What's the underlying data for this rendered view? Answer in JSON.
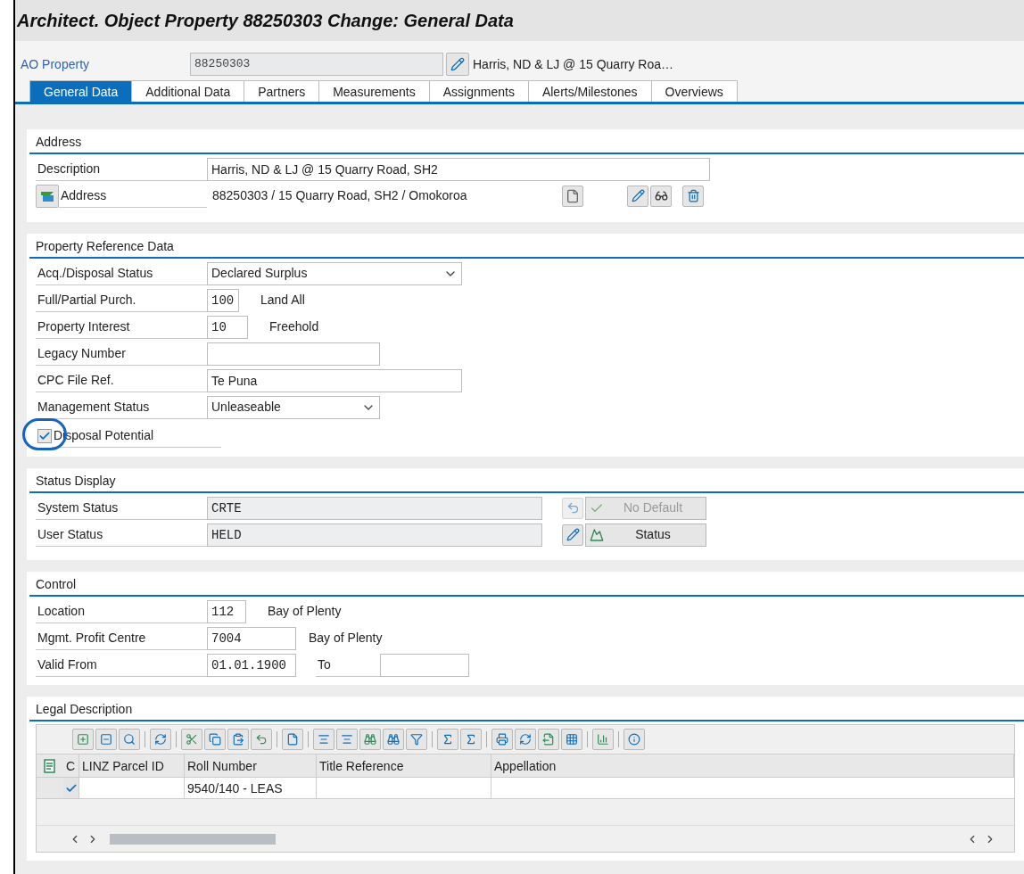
{
  "window": {
    "title": "Architect. Object Property 88250303 Change: General Data"
  },
  "header": {
    "label": "AO Property",
    "value": "88250303",
    "description": "Harris, ND & LJ @ 15 Quarry Roa…"
  },
  "tabs": [
    {
      "label": "General Data",
      "selected": true
    },
    {
      "label": "Additional Data",
      "selected": false
    },
    {
      "label": "Partners",
      "selected": false
    },
    {
      "label": "Measurements",
      "selected": false
    },
    {
      "label": "Assignments",
      "selected": false
    },
    {
      "label": "Alerts/Milestones",
      "selected": false
    },
    {
      "label": "Overviews",
      "selected": false
    }
  ],
  "address": {
    "title": "Address",
    "description_label": "Description",
    "description_value": "Harris, ND & LJ @ 15 Quarry Road, SH2",
    "address_label": "Address",
    "address_value": "88250303 / 15 Quarry Road, SH2 / Omokoroa"
  },
  "property_reference": {
    "title": "Property Reference Data",
    "fields": [
      {
        "kind": "select",
        "label": "Acq./Disposal Status",
        "value": "Declared Surplus"
      },
      {
        "kind": "input",
        "label": "Full/Partial Purch.",
        "value": "100",
        "text": "Land All"
      },
      {
        "kind": "input",
        "label": "Property Interest",
        "value": "10",
        "text": "Freehold"
      },
      {
        "kind": "input",
        "label": "Legacy Number"
      },
      {
        "kind": "input",
        "label": "CPC File Ref.",
        "value": "Te Puna"
      },
      {
        "kind": "select",
        "label": "Management Status",
        "value": "Unleaseable"
      },
      {
        "kind": "checkbox",
        "label": "Disposal Potential",
        "checked": true,
        "circled": true
      }
    ]
  },
  "status_display": {
    "title": "Status Display",
    "rows": [
      {
        "label": "System Status",
        "value": "CRTE"
      },
      {
        "label": "User Status",
        "value": "HELD"
      }
    ],
    "buttons": [
      {
        "label": "No Default",
        "disabled": true
      },
      {
        "label": "Status",
        "disabled": false
      }
    ]
  },
  "control": {
    "title": "Control",
    "location": {
      "label": "Location",
      "value": "112",
      "text": "Bay of Plenty"
    },
    "profit_centre": {
      "label": "Mgmt. Profit Centre",
      "value": "7004",
      "text": "Bay of Plenty"
    },
    "valid": {
      "label": "Valid From",
      "value": "01.01.1900",
      "to_label": "To"
    }
  },
  "legal_description": {
    "title": "Legal Description",
    "columns": [
      "C",
      "LINZ Parcel ID",
      "Roll Number",
      "Title Reference",
      "Appellation"
    ],
    "rows": [
      {
        "checked": true,
        "roll_number": "9540/140 - LEAS"
      }
    ]
  }
}
